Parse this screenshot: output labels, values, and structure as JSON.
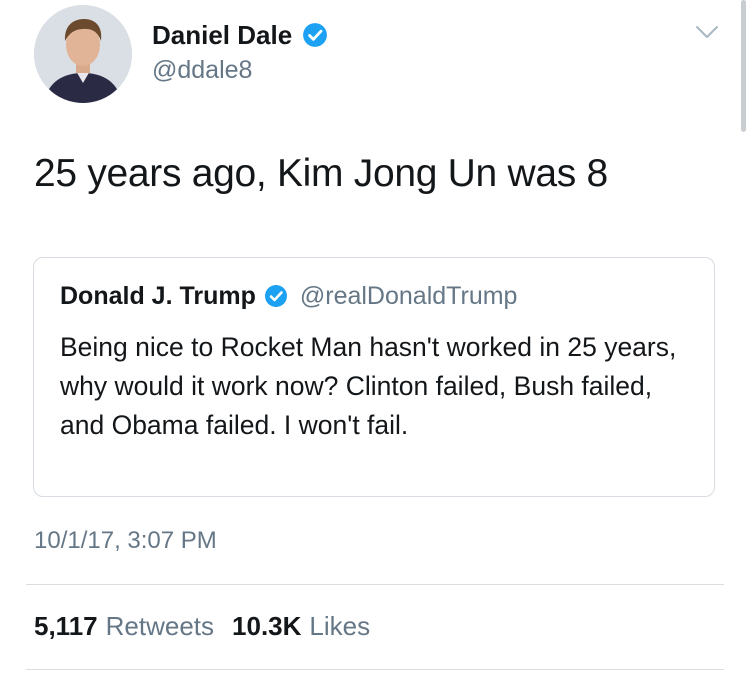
{
  "author": {
    "display_name": "Daniel Dale",
    "handle": "@ddale8",
    "verified_icon": "verified-badge-icon"
  },
  "tweet": {
    "text": "25 years ago, Kim Jong Un was 8"
  },
  "quoted_tweet": {
    "display_name": "Donald J. Trump",
    "handle": "@realDonaldTrump",
    "text": "Being nice to Rocket Man hasn't worked in 25 years, why would it work now? Clinton failed, Bush failed, and Obama failed. I won't fail."
  },
  "timestamp": "10/1/17, 3:07 PM",
  "stats": {
    "retweets_count": "5,117",
    "retweets_label": "Retweets",
    "likes_count": "10.3K",
    "likes_label": "Likes"
  },
  "colors": {
    "verified": "#1da1f2",
    "secondary_text": "#657786",
    "primary_text": "#14171a",
    "border": "#d6dce1"
  }
}
